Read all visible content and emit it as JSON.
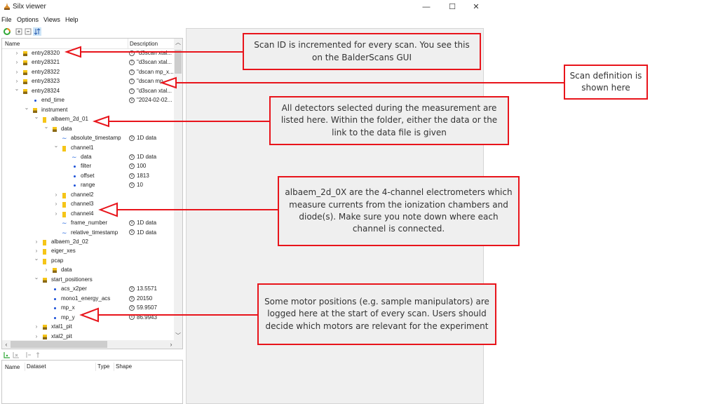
{
  "window": {
    "title": "Silx viewer",
    "controls": {
      "minimize": "—",
      "maximize": "☐",
      "close": "✕"
    }
  },
  "menu": [
    "File",
    "Options",
    "Views",
    "Help"
  ],
  "toolbar": {
    "icons": [
      "refresh-icon",
      "expand-all-icon",
      "collapse-all-icon",
      "sort-icon"
    ]
  },
  "tree": {
    "columns": {
      "name": "Name",
      "description": "Description"
    },
    "rows": [
      {
        "depth": 0,
        "arrow": "›",
        "icon": "h5",
        "name": "entry28320",
        "badge": "T",
        "desc": "\"d3scan xtal..."
      },
      {
        "depth": 0,
        "arrow": "›",
        "icon": "h5",
        "name": "entry28321",
        "badge": "T",
        "desc": "\"d3scan xtal..."
      },
      {
        "depth": 0,
        "arrow": "›",
        "icon": "h5",
        "name": "entry28322",
        "badge": "T",
        "desc": "\"dscan mp_x..."
      },
      {
        "depth": 0,
        "arrow": "›",
        "icon": "h5",
        "name": "entry28323",
        "badge": "T",
        "desc": "\"dscan mp_..."
      },
      {
        "depth": 0,
        "arrow": "⌄",
        "icon": "h5",
        "name": "entry28324",
        "badge": "T",
        "desc": "\"d3scan xtal..."
      },
      {
        "depth": 1,
        "arrow": "",
        "icon": "dot",
        "name": "end_time",
        "badge": "V",
        "desc": "\"2024-02-02..."
      },
      {
        "depth": 1,
        "arrow": "⌄",
        "icon": "h5",
        "name": "instrument",
        "badge": "",
        "desc": ""
      },
      {
        "depth": 2,
        "arrow": "⌄",
        "icon": "folder",
        "name": "albaem_2d_01",
        "badge": "",
        "desc": ""
      },
      {
        "depth": 3,
        "arrow": "⌄",
        "icon": "h5",
        "name": "data",
        "badge": "",
        "desc": ""
      },
      {
        "depth": 4,
        "arrow": "",
        "icon": "wave",
        "name": "absolute_timestamp",
        "badge": "V",
        "desc": "1D data"
      },
      {
        "depth": 4,
        "arrow": "⌄",
        "icon": "folder",
        "name": "channel1",
        "badge": "",
        "desc": ""
      },
      {
        "depth": 5,
        "arrow": "",
        "icon": "wave",
        "name": "data",
        "badge": "V",
        "desc": "1D data"
      },
      {
        "depth": 5,
        "arrow": "",
        "icon": "dot",
        "name": "filter",
        "badge": "V",
        "desc": "100"
      },
      {
        "depth": 5,
        "arrow": "",
        "icon": "dot",
        "name": "offset",
        "badge": "V",
        "desc": "1813"
      },
      {
        "depth": 5,
        "arrow": "",
        "icon": "dot",
        "name": "range",
        "badge": "V",
        "desc": "10"
      },
      {
        "depth": 4,
        "arrow": "›",
        "icon": "folder",
        "name": "channel2",
        "badge": "",
        "desc": ""
      },
      {
        "depth": 4,
        "arrow": "›",
        "icon": "folder",
        "name": "channel3",
        "badge": "",
        "desc": ""
      },
      {
        "depth": 4,
        "arrow": "›",
        "icon": "folder",
        "name": "channel4",
        "badge": "",
        "desc": ""
      },
      {
        "depth": 4,
        "arrow": "",
        "icon": "wave",
        "name": "frame_number",
        "badge": "V",
        "desc": "1D data"
      },
      {
        "depth": 4,
        "arrow": "",
        "icon": "wave",
        "name": "relative_timestamp",
        "badge": "V",
        "desc": "1D data"
      },
      {
        "depth": 2,
        "arrow": "›",
        "icon": "folder",
        "name": "albaem_2d_02",
        "badge": "",
        "desc": ""
      },
      {
        "depth": 2,
        "arrow": "›",
        "icon": "folder",
        "name": "eiger_xes",
        "badge": "",
        "desc": ""
      },
      {
        "depth": 2,
        "arrow": "⌄",
        "icon": "folder",
        "name": "pcap",
        "badge": "",
        "desc": ""
      },
      {
        "depth": 3,
        "arrow": "›",
        "icon": "h5",
        "name": "data",
        "badge": "",
        "desc": ""
      },
      {
        "depth": 2,
        "arrow": "⌄",
        "icon": "h5",
        "name": "start_positioners",
        "badge": "",
        "desc": ""
      },
      {
        "depth": 3,
        "arrow": "",
        "icon": "dot",
        "name": "acs_x2per",
        "badge": "V",
        "desc": "13.5571"
      },
      {
        "depth": 3,
        "arrow": "",
        "icon": "dot",
        "name": "mono1_energy_acs",
        "badge": "V",
        "desc": "20150"
      },
      {
        "depth": 3,
        "arrow": "",
        "icon": "dot",
        "name": "mp_x",
        "badge": "V",
        "desc": "59.9507"
      },
      {
        "depth": 3,
        "arrow": "",
        "icon": "dot",
        "name": "mp_y",
        "badge": "V",
        "desc": "86.9943"
      },
      {
        "depth": 2,
        "arrow": "›",
        "icon": "h5",
        "name": "xtal1_pit",
        "badge": "",
        "desc": ""
      },
      {
        "depth": 2,
        "arrow": "›",
        "icon": "h5",
        "name": "xtal2_pit",
        "badge": "",
        "desc": ""
      }
    ]
  },
  "datasets": {
    "columns": [
      "Name",
      "Dataset",
      "Type",
      "Shape"
    ]
  },
  "annotations": {
    "scan_id": "Scan ID is incremented for every scan. You see this on the BalderScans GUI",
    "scan_definition": "Scan definition is shown here",
    "detectors": "All detectors selected during the measurement are listed here. Within the folder, either the data or the link to the data file is given",
    "electrometers": "albaem_2d_0X are the 4-channel electrometers which measure currents from the ionization chambers and diode(s). Make sure you note down where each channel is connected.",
    "motors": "Some motor positions (e.g. sample manipulators) are logged here at the start of every scan. Users should decide which motors are relevant for the experiment"
  },
  "colors": {
    "annotation_red": "#e8141b",
    "folder_yellow": "#f5c518",
    "link_blue": "#2f6de0"
  }
}
